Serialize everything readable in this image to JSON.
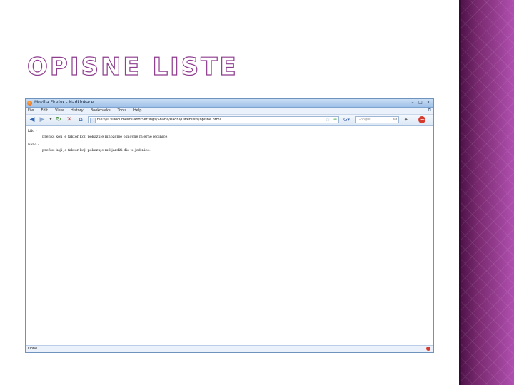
{
  "slide": {
    "title": "OPISNE LISTE"
  },
  "browser": {
    "window_title": "Mozilla Firefox - Nadklokace",
    "window_buttons": [
      "–",
      "□",
      "×"
    ],
    "menu": [
      "File",
      "Edit",
      "View",
      "History",
      "Bookmarks",
      "Tools",
      "Help"
    ],
    "address": "file:///C:/Documents and Settings/Shana/Radni/Oweblists/opisne.html",
    "search_engine_icon": "G▾",
    "search_placeholder": "Google",
    "adblock_label": "ABP",
    "status": "Done"
  },
  "content": {
    "items": [
      {
        "term": "kilo -",
        "definition": "prefiks koji je faktor koji pokazuje množenje osnovne mjerne jedinice."
      },
      {
        "term": "nano -",
        "definition": "prefiks koji je faktor koji pokazuje milijarditi dio te jedinice."
      }
    ]
  },
  "colors": {
    "accent": "#8f3d8f",
    "strip": "#7a2a70",
    "chrome": "#c9def5"
  }
}
